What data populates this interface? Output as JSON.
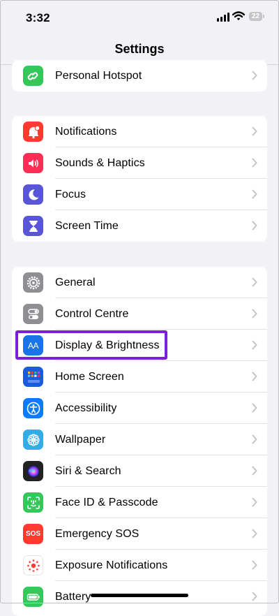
{
  "status_bar": {
    "time": "3:32",
    "battery": "22"
  },
  "nav": {
    "title": "Settings"
  },
  "groups": [
    {
      "items": [
        {
          "label": "Personal Hotspot",
          "icon": "personal-hotspot-icon",
          "color": "#34c759"
        }
      ]
    },
    {
      "items": [
        {
          "label": "Notifications",
          "icon": "notifications-icon",
          "color": "#ff3b30"
        },
        {
          "label": "Sounds & Haptics",
          "icon": "sounds-icon",
          "color": "#ff2d55"
        },
        {
          "label": "Focus",
          "icon": "focus-moon-icon",
          "color": "#5856d6"
        },
        {
          "label": "Screen Time",
          "icon": "screen-time-hourglass-icon",
          "color": "#5856d6"
        }
      ]
    },
    {
      "items": [
        {
          "label": "General",
          "icon": "general-gear-icon",
          "color": "#8e8e93"
        },
        {
          "label": "Control Centre",
          "icon": "control-centre-toggles-icon",
          "color": "#8e8e93"
        },
        {
          "label": "Display & Brightness",
          "icon": "display-brightness-aa-icon",
          "color": "#1a73e8",
          "icon_text": "AA",
          "highlighted": true
        },
        {
          "label": "Home Screen",
          "icon": "home-screen-grid-icon",
          "color": "#1a5adc"
        },
        {
          "label": "Accessibility",
          "icon": "accessibility-icon",
          "color": "#0a7aff"
        },
        {
          "label": "Wallpaper",
          "icon": "wallpaper-flower-icon",
          "color": "#32ade6"
        },
        {
          "label": "Siri & Search",
          "icon": "siri-orb-icon",
          "color": "#222222"
        },
        {
          "label": "Face ID & Passcode",
          "icon": "face-id-icon",
          "color": "#34c759"
        },
        {
          "label": "Emergency SOS",
          "icon": "emergency-sos-icon",
          "color": "#ff3b30",
          "icon_text": "SOS"
        },
        {
          "label": "Exposure Notifications",
          "icon": "exposure-notifications-icon",
          "color": "#ffffff"
        },
        {
          "label": "Battery",
          "icon": "battery-icon",
          "color": "#34c759"
        }
      ]
    }
  ]
}
